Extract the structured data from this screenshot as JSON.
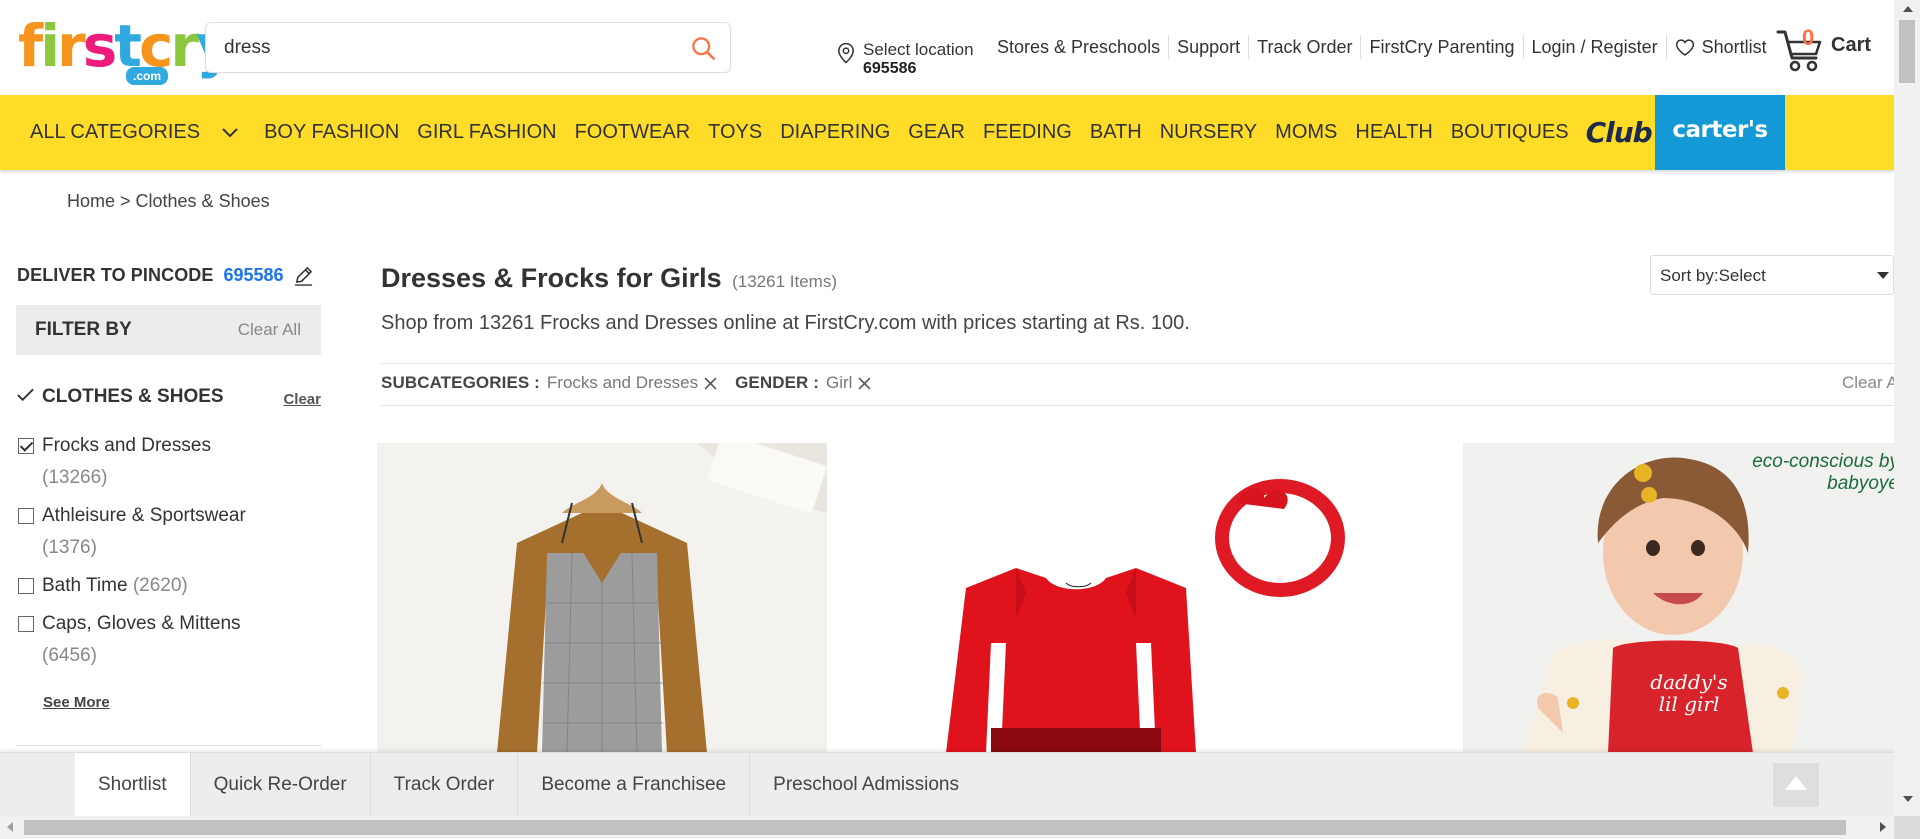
{
  "header": {
    "logo": {
      "letters": [
        "f",
        "i",
        "r",
        "s",
        "t",
        "c",
        "r",
        "y"
      ],
      "colors": [
        "#f7941d",
        "#8dc63f",
        "#f7941d",
        "#ed1c7a",
        "#30a9de",
        "#f7941d",
        "#8dc63f",
        "#30a9de"
      ],
      "suffix": ".com"
    },
    "search": {
      "value": "dress",
      "icon": "search-icon",
      "icon_color": "#ff7043"
    },
    "location": {
      "label": "Select location",
      "pincode": "695586",
      "icon": "location-pin-icon"
    },
    "links": [
      "Stores & Preschools",
      "Support",
      "Track Order",
      "FirstCry Parenting",
      "Login / Register"
    ],
    "shortlist": {
      "label": "Shortlist",
      "icon": "heart-icon"
    },
    "cart": {
      "count": "0",
      "label": "Cart",
      "icon": "cart-icon",
      "count_color": "#ff7043"
    }
  },
  "nav": {
    "background": "#fedc28",
    "all_categories": "ALL CATEGORIES",
    "items": [
      "BOY FASHION",
      "GIRL FASHION",
      "FOOTWEAR",
      "TOYS",
      "DIAPERING",
      "GEAR",
      "FEEDING",
      "BATH",
      "NURSERY",
      "MOMS",
      "HEALTH",
      "BOUTIQUES"
    ],
    "club": "Club",
    "carters": "carter's",
    "carters_color": "#1399d6"
  },
  "breadcrumb": "Home > Clothes & Shoes",
  "sidebar": {
    "pincode_label": "DELIVER TO PINCODE",
    "pincode_value": "695586",
    "filter_by": "FILTER BY",
    "clear_all": "Clear All",
    "section_title": "CLOTHES & SHOES",
    "section_clear": "Clear",
    "options": [
      {
        "label": "Frocks and Dresses",
        "count": "(13266)",
        "checked": true
      },
      {
        "label": "Athleisure & Sportswear",
        "count": "(1376)",
        "checked": false
      },
      {
        "label": "Bath Time",
        "count": "(2620)",
        "checked": false
      },
      {
        "label": "Caps, Gloves & Mittens",
        "count": "(6456)",
        "checked": false
      }
    ],
    "see_more": "See More"
  },
  "main": {
    "title": "Dresses & Frocks for Girls",
    "item_count": "(13261 Items)",
    "description": "Shop from 13261 Frocks and Dresses online at FirstCry.com with prices starting at Rs. 100.",
    "sort_label": "Sort by:",
    "sort_value": "Select",
    "filters": [
      {
        "key": "SUBCATEGORIES :",
        "value": "Frocks and Dresses"
      },
      {
        "key": "GENDER :",
        "value": "Girl"
      }
    ],
    "clear_all": "Clear All",
    "products": [
      {
        "image": "girls-plaid-pinafore-dress-photo",
        "brand_text": ""
      },
      {
        "image": "red-frock-with-headband-photo",
        "brand_text": ""
      },
      {
        "image": "toddler-in-red-apron-dress-photo",
        "brand_text": "eco-conscious by babyoye",
        "print_text": "daddy's lil girl"
      }
    ]
  },
  "footer_bar": {
    "tabs": [
      "Shortlist",
      "Quick Re-Order",
      "Track Order",
      "Become a Franchisee",
      "Preschool Admissions"
    ],
    "active_tab": 0
  }
}
